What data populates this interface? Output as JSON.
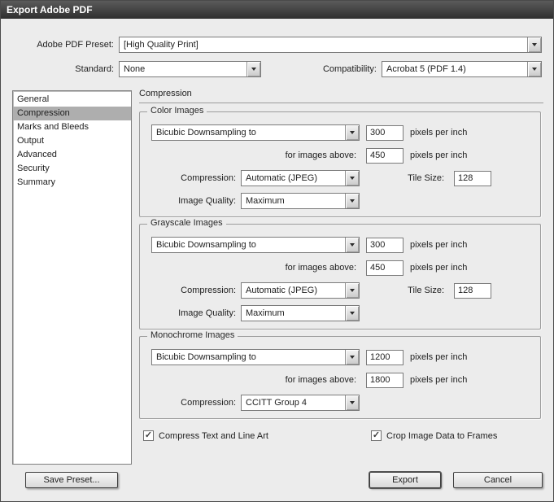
{
  "window": {
    "title": "Export Adobe PDF"
  },
  "preset": {
    "label": "Adobe PDF Preset:",
    "value": "[High Quality Print]"
  },
  "standard": {
    "label": "Standard:",
    "value": "None"
  },
  "compatibility": {
    "label": "Compatibility:",
    "value": "Acrobat 5 (PDF 1.4)"
  },
  "sidebar": {
    "selected": "Compression",
    "items": [
      {
        "label": "General"
      },
      {
        "label": "Compression"
      },
      {
        "label": "Marks and Bleeds"
      },
      {
        "label": "Output"
      },
      {
        "label": "Advanced"
      },
      {
        "label": "Security"
      },
      {
        "label": "Summary"
      }
    ]
  },
  "panel": {
    "title": "Compression"
  },
  "groups": [
    {
      "title": "Color Images",
      "sampling": "Bicubic Downsampling to",
      "ppi": "300",
      "ppi_unit": "pixels per inch",
      "above_label": "for images above:",
      "above": "450",
      "above_unit": "pixels per inch",
      "compression_label": "Compression:",
      "compression": "Automatic (JPEG)",
      "tile_label": "Tile Size:",
      "tile": "128",
      "quality_label": "Image Quality:",
      "quality": "Maximum"
    },
    {
      "title": "Grayscale Images",
      "sampling": "Bicubic Downsampling to",
      "ppi": "300",
      "ppi_unit": "pixels per inch",
      "above_label": "for images above:",
      "above": "450",
      "above_unit": "pixels per inch",
      "compression_label": "Compression:",
      "compression": "Automatic (JPEG)",
      "tile_label": "Tile Size:",
      "tile": "128",
      "quality_label": "Image Quality:",
      "quality": "Maximum"
    },
    {
      "title": "Monochrome Images",
      "sampling": "Bicubic Downsampling to",
      "ppi": "1200",
      "ppi_unit": "pixels per inch",
      "above_label": "for images above:",
      "above": "1800",
      "above_unit": "pixels per inch",
      "compression_label": "Compression:",
      "compression": "CCITT Group 4"
    }
  ],
  "options": {
    "compress_text": {
      "label": "Compress Text and Line Art",
      "checked": true
    },
    "crop_frames": {
      "label": "Crop Image Data to Frames",
      "checked": true
    }
  },
  "buttons": {
    "save_preset": "Save Preset...",
    "export": "Export",
    "cancel": "Cancel"
  }
}
